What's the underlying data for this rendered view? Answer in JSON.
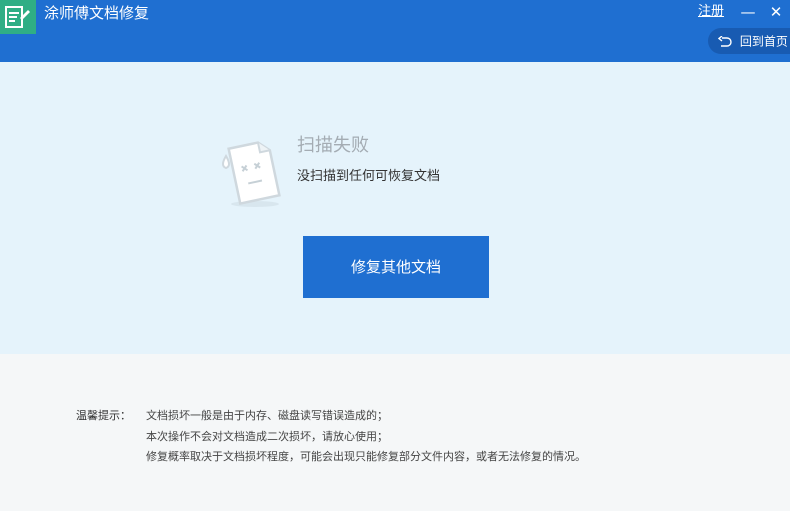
{
  "app": {
    "title": "涂师傅文档修复",
    "brand_color": "#1f6fd1",
    "logo_color": "#2fae85"
  },
  "titlebar": {
    "register": "注册",
    "minimize_glyph": "—",
    "close_glyph": "✕",
    "home_button": "回到首页"
  },
  "status": {
    "title": "扫描失败",
    "description": "没扫描到任何可恢复文档",
    "icon": "sad-document-icon"
  },
  "actions": {
    "repair_other": "修复其他文档"
  },
  "tips": {
    "label": "温馨提示：",
    "lines": [
      "文档损坏一般是由于内存、磁盘读写错误造成的；",
      "本次操作不会对文档造成二次损坏，请放心使用；",
      "修复概率取决于文档损坏程度，可能会出现只能修复部分文件内容，或者无法修复的情况。"
    ]
  }
}
